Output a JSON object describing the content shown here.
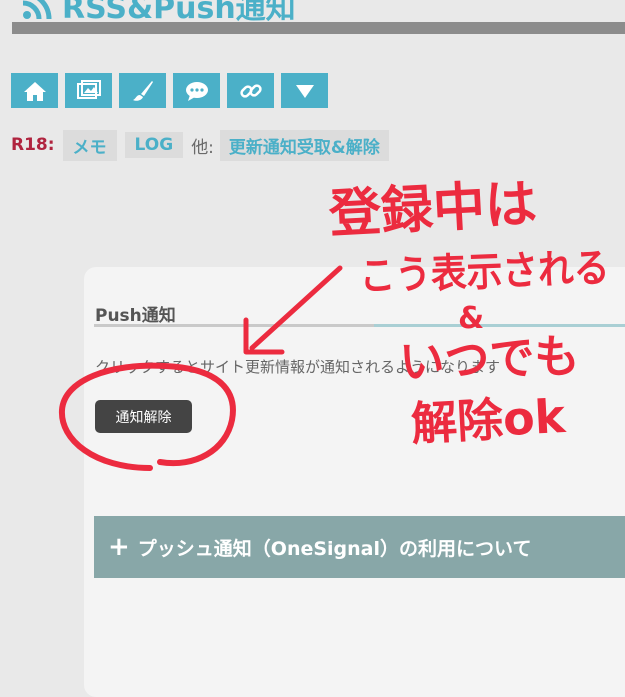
{
  "site": {
    "title": "RSS&Push通知"
  },
  "nav": {
    "icons": [
      "home-icon",
      "image-icon",
      "brush-icon",
      "chat-icon",
      "link-icon",
      "dropdown-triangle-icon"
    ],
    "color": "#4bb0c8"
  },
  "r18_row": {
    "label": "R18:",
    "tags": [
      "メモ",
      "LOG"
    ],
    "other": "他:",
    "link": "更新通知受取&解除"
  },
  "card": {
    "title": "Push通知",
    "description": "クリックするとサイト更新情報が通知されるようになります",
    "button_label": "通知解除",
    "accordion_label": "プッシュ通知（OneSignal）の利用について"
  },
  "annotation": {
    "line1": "登録中は",
    "line2": "こう表示される",
    "line3": "&",
    "line4": "いつでも",
    "line5": "解除ok",
    "color": "#ec2b3f"
  }
}
